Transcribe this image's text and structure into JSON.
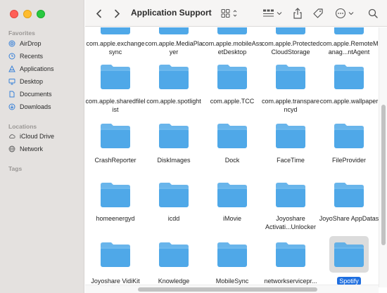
{
  "window": {
    "title": "Application Support"
  },
  "sidebar": {
    "favorites_heading": "Favorites",
    "favorites": [
      {
        "label": "AirDrop",
        "icon": "airdrop-icon"
      },
      {
        "label": "Recents",
        "icon": "clock-icon"
      },
      {
        "label": "Applications",
        "icon": "applications-icon"
      },
      {
        "label": "Desktop",
        "icon": "desktop-icon"
      },
      {
        "label": "Documents",
        "icon": "document-icon"
      },
      {
        "label": "Downloads",
        "icon": "download-icon"
      }
    ],
    "locations_heading": "Locations",
    "locations": [
      {
        "label": "iCloud Drive",
        "icon": "cloud-icon"
      },
      {
        "label": "Network",
        "icon": "network-icon"
      }
    ],
    "tags_heading": "Tags"
  },
  "colors": {
    "folder": "#4fa8e8",
    "selection": "#1f6fe0",
    "sidebar_bg": "#e4e1df",
    "icon_blue": "#3a82d8"
  },
  "files": [
    {
      "name": "com.apple.exchangesync"
    },
    {
      "name": "com.apple.MediaPlayer"
    },
    {
      "name": "com.apple.mobileAssetDesktop"
    },
    {
      "name": "com.apple.ProtectedCloudStorage"
    },
    {
      "name": "com.apple.RemoteManag...ntAgent"
    },
    {
      "name": "com.apple.sharedfilelist"
    },
    {
      "name": "com.apple.spotlight"
    },
    {
      "name": "com.apple.TCC"
    },
    {
      "name": "com.apple.transparencyd"
    },
    {
      "name": "com.apple.wallpaper"
    },
    {
      "name": "CrashReporter"
    },
    {
      "name": "DiskImages"
    },
    {
      "name": "Dock"
    },
    {
      "name": "FaceTime"
    },
    {
      "name": "FileProvider"
    },
    {
      "name": "homeenergyd"
    },
    {
      "name": "icdd"
    },
    {
      "name": "iMovie"
    },
    {
      "name": "Joyoshare Activati...Unlocker"
    },
    {
      "name": "JoyoShare AppDatas"
    },
    {
      "name": "Joyoshare VidiKit"
    },
    {
      "name": "Knowledge"
    },
    {
      "name": "MobileSync"
    },
    {
      "name": "networkservicepr..."
    },
    {
      "name": "Spotify",
      "selected": true
    }
  ]
}
